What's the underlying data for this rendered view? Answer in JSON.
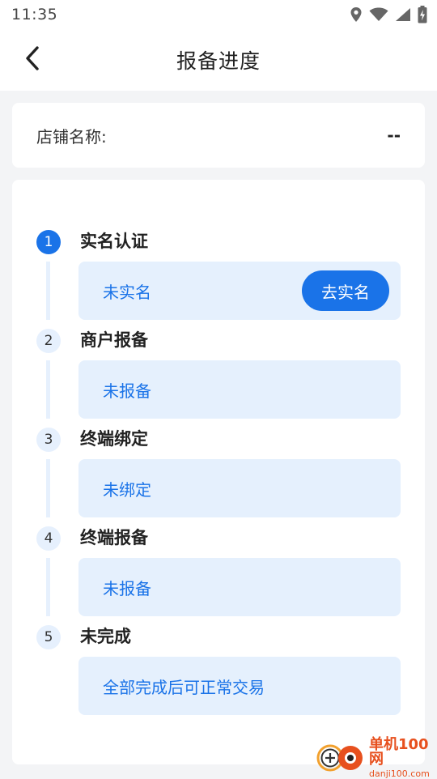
{
  "status_bar": {
    "time": "11:35",
    "icons": [
      "location-icon",
      "wifi-icon",
      "signal-icon",
      "battery-charging-icon"
    ]
  },
  "app_bar": {
    "title": "报备进度",
    "back_icon": "chevron-left-icon"
  },
  "store": {
    "label": "店铺名称:",
    "value": "--"
  },
  "steps": [
    {
      "number": "1",
      "title": "实名认证",
      "status": "未实名",
      "action": "去实名",
      "active": true
    },
    {
      "number": "2",
      "title": "商户报备",
      "status": "未报备"
    },
    {
      "number": "3",
      "title": "终端绑定",
      "status": "未绑定"
    },
    {
      "number": "4",
      "title": "终端报备",
      "status": "未报备"
    },
    {
      "number": "5",
      "title": "未完成",
      "status": "全部完成后可正常交易"
    }
  ],
  "watermark": {
    "main": "单机100网",
    "sub": "danji100.com"
  },
  "colors": {
    "accent": "#1a73e8",
    "step_bg": "#e5f0fd",
    "page_bg": "#f3f4f6"
  }
}
